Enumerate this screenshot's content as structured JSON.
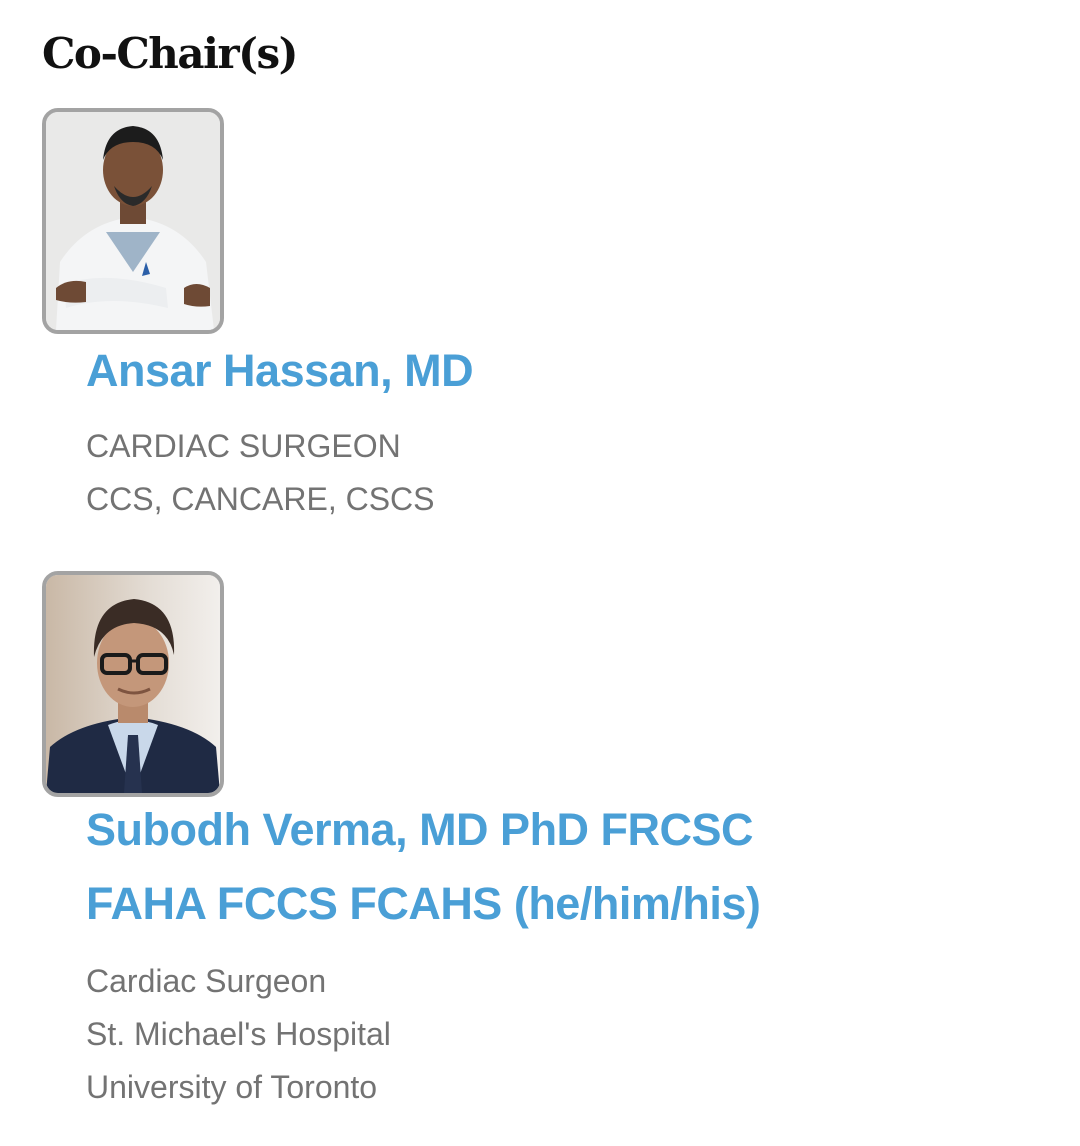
{
  "section": {
    "title": "Co-Chair(s)"
  },
  "people": [
    {
      "name_lines": [
        "Ansar Hassan, MD"
      ],
      "details": [
        "CARDIAC SURGEON",
        "CCS, CANCARE, CSCS"
      ]
    },
    {
      "name_lines": [
        "Subodh Verma, MD PhD FRCSC",
        "FAHA FCCS FCAHS (he/him/his)"
      ],
      "details": [
        "Cardiac Surgeon",
        "St. Michael's Hospital",
        "University of Toronto"
      ]
    }
  ],
  "colors": {
    "name_link": "#4a9fd6",
    "detail_text": "#737373",
    "title_text": "#111111",
    "photo_border": "#a3a3a3"
  }
}
